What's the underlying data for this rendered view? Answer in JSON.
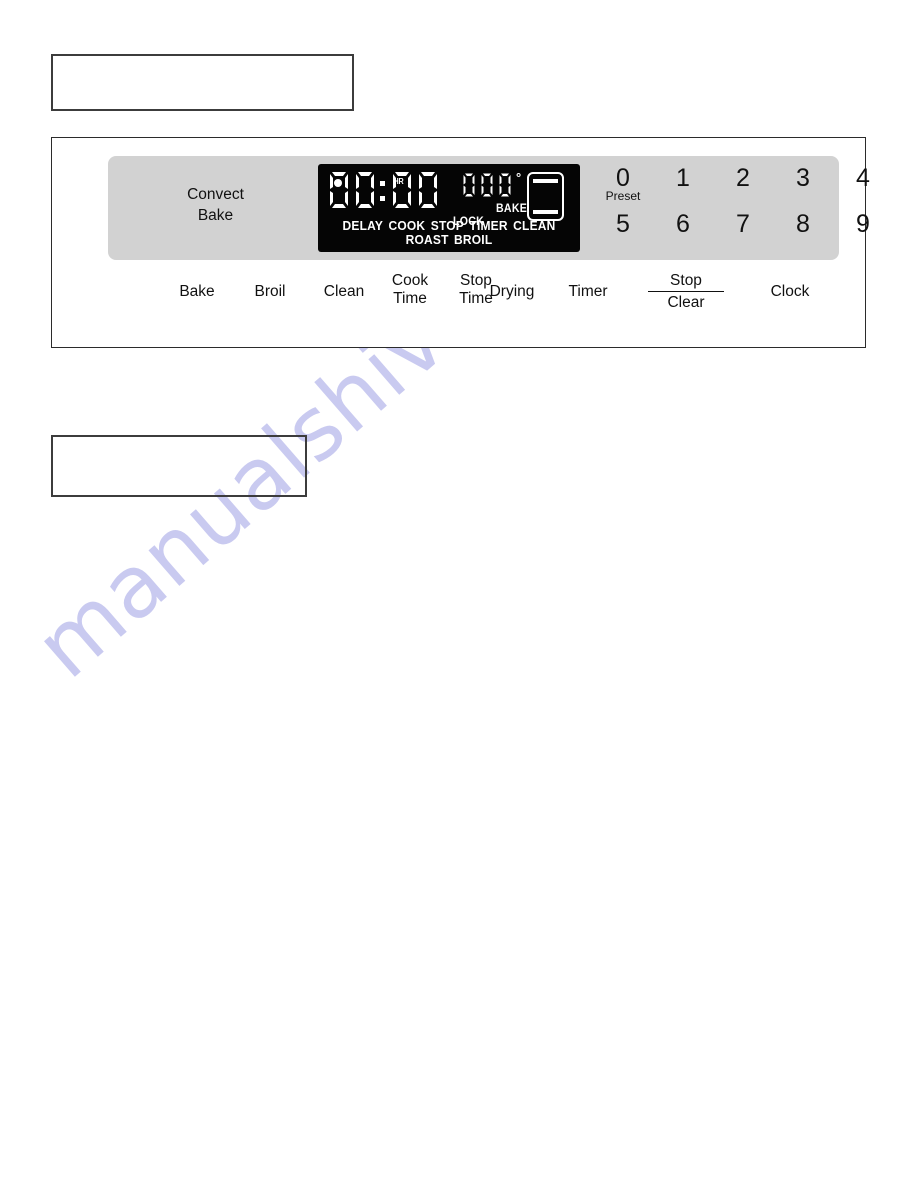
{
  "page": {
    "watermark": "manualshive.com",
    "watermark_color": "#c9caf0",
    "background_color": "#ffffff"
  },
  "caption_boxes": [
    {
      "name": "top-empty-box",
      "text": ""
    },
    {
      "name": "middle-empty-box",
      "text": ""
    }
  ],
  "control_panel": {
    "pad_color": "#d2d2d2",
    "convect_label": {
      "line1": "Convect",
      "line2": "Bake"
    },
    "display": {
      "background_color": "#050505",
      "foreground_color": "#ffffff",
      "clock_value": "00:00",
      "clock_digits": [
        "0",
        "0",
        "0",
        "0"
      ],
      "colon": ":",
      "dot_indicator": "•",
      "hr_indicator": "HR",
      "temperature_value": "000",
      "temperature_digits": [
        "0",
        "0",
        "0"
      ],
      "degree_symbol": "°",
      "lock_indicator": "LOCK",
      "bake_indicator": "BAKE",
      "oven_icon": "oven-element-icon",
      "status_indicators": [
        "DELAY",
        "COOK",
        "STOP",
        "TIMER",
        "CLEAN",
        "ROAST",
        "BROIL"
      ]
    },
    "keypad": {
      "row1": [
        {
          "digit": "0",
          "sub": "Preset"
        },
        {
          "digit": "1",
          "sub": ""
        },
        {
          "digit": "2",
          "sub": ""
        },
        {
          "digit": "3",
          "sub": ""
        },
        {
          "digit": "4",
          "sub": ""
        }
      ],
      "row2": [
        {
          "digit": "5",
          "sub": ""
        },
        {
          "digit": "6",
          "sub": ""
        },
        {
          "digit": "7",
          "sub": ""
        },
        {
          "digit": "8",
          "sub": ""
        },
        {
          "digit": "9",
          "sub": ""
        }
      ]
    },
    "buttons": [
      {
        "name": "bake",
        "line1": "Bake",
        "line2": "",
        "style": "single"
      },
      {
        "name": "broil",
        "line1": "Broil",
        "line2": "",
        "style": "single"
      },
      {
        "name": "clean",
        "line1": "Clean",
        "line2": "",
        "style": "single"
      },
      {
        "name": "cook-time",
        "line1": "Cook",
        "line2": "Time",
        "style": "stacked"
      },
      {
        "name": "stop-time",
        "line1": "Stop",
        "line2": "Time",
        "style": "stacked"
      },
      {
        "name": "drying",
        "line1": "Drying",
        "line2": "",
        "style": "single"
      },
      {
        "name": "timer",
        "line1": "Timer",
        "line2": "",
        "style": "single"
      },
      {
        "name": "stop-clear",
        "line1": "Stop",
        "line2": "Clear",
        "style": "fraction"
      },
      {
        "name": "clock",
        "line1": "Clock",
        "line2": "",
        "style": "single"
      }
    ]
  }
}
